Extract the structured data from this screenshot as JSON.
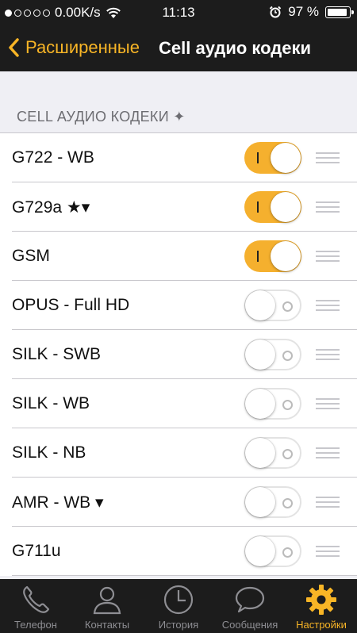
{
  "status_bar": {
    "carrier_speed": "0.00K/s",
    "signal_dots": [
      true,
      false,
      false,
      false,
      false
    ],
    "time": "11:13",
    "battery": "97 %",
    "battery_level": 0.97
  },
  "nav": {
    "back_label": "Расширенные",
    "title": "Cell аудио кодеки"
  },
  "section": {
    "header": "CELL АУДИО КОДЕКИ ✦"
  },
  "codecs": [
    {
      "label": "G722 - WB",
      "enabled": true
    },
    {
      "label": "G729a ★▾",
      "enabled": true
    },
    {
      "label": "GSM",
      "enabled": true
    },
    {
      "label": "OPUS - Full HD",
      "enabled": false
    },
    {
      "label": "SILK - SWB",
      "enabled": false
    },
    {
      "label": "SILK - WB",
      "enabled": false
    },
    {
      "label": "SILK - NB",
      "enabled": false
    },
    {
      "label": "AMR - WB ▾",
      "enabled": false
    },
    {
      "label": "G711u",
      "enabled": false
    }
  ],
  "tabbar": {
    "tabs": [
      {
        "label": "Телефон",
        "icon": "phone-icon",
        "active": false
      },
      {
        "label": "Контакты",
        "icon": "contacts-icon",
        "active": false
      },
      {
        "label": "История",
        "icon": "clock-icon",
        "active": false
      },
      {
        "label": "Сообщения",
        "icon": "message-icon",
        "active": false
      },
      {
        "label": "Настройки",
        "icon": "gear-icon",
        "active": true
      }
    ]
  },
  "colors": {
    "accent": "#f8b526",
    "toggle_on": "#f5b02e",
    "bar_background": "#1c1c1c",
    "page_background": "#efeff4",
    "inactive_tab": "#8e8e93"
  }
}
